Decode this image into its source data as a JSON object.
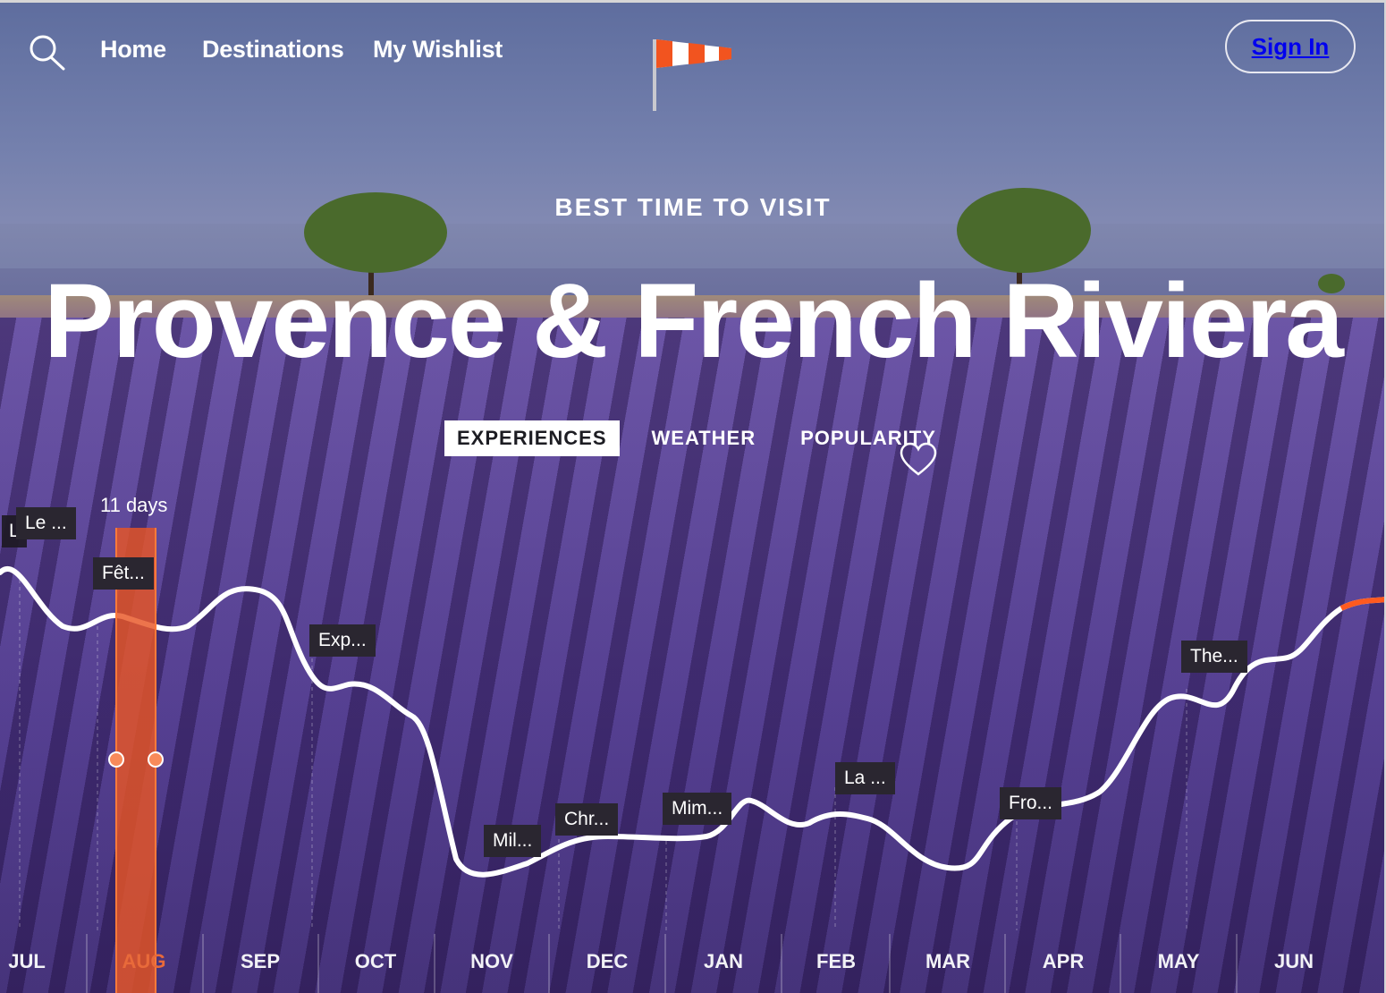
{
  "nav": {
    "links": [
      "Home",
      "Destinations",
      "My Wishlist"
    ],
    "sign_in": "Sign In"
  },
  "hero": {
    "eyebrow": "BEST TIME TO VISIT",
    "title": "Provence & French Riviera"
  },
  "tabs": [
    {
      "label": "EXPERIENCES",
      "active": true
    },
    {
      "label": "WEATHER",
      "active": false
    },
    {
      "label": "POPULARITY",
      "active": false
    }
  ],
  "selection": {
    "duration_label": "11 days",
    "month": "AUG"
  },
  "chart_data": {
    "type": "line",
    "categories": [
      "JUL",
      "AUG",
      "SEP",
      "OCT",
      "NOV",
      "DEC",
      "JAN",
      "FEB",
      "MAR",
      "APR",
      "MAY",
      "JUN"
    ],
    "experiences": [
      {
        "label": "L"
      },
      {
        "label": "Le ..."
      },
      {
        "label": "Fêt..."
      },
      {
        "label": "Exp..."
      },
      {
        "label": "Mil..."
      },
      {
        "label": "Chr..."
      },
      {
        "label": "Mim..."
      },
      {
        "label": "La ..."
      },
      {
        "label": "Fro..."
      },
      {
        "label": "The..."
      }
    ]
  },
  "colors": {
    "accent": "#e85624",
    "line": "#ffffff",
    "tag_bg": "#2a2630"
  }
}
